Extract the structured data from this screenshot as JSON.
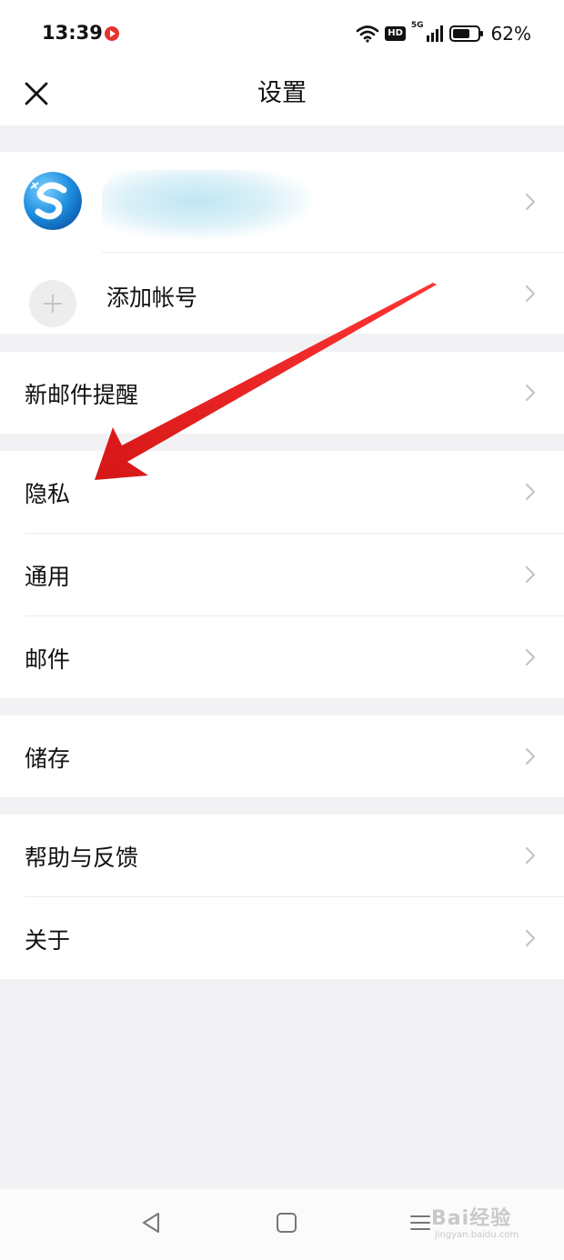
{
  "status_bar": {
    "time": "13:39",
    "hd_badge": "HD",
    "network": "5G",
    "battery": "62%",
    "icons": [
      "record-icon",
      "wifi-icon",
      "signal-icon",
      "battery-icon"
    ]
  },
  "header": {
    "title": "设置"
  },
  "account": {
    "add_label": "添加帐号"
  },
  "menu": {
    "new_mail_alert": "新邮件提醒",
    "privacy": "隐私",
    "general": "通用",
    "mail": "邮件",
    "storage": "储存",
    "help_feedback": "帮助与反馈",
    "about": "关于"
  },
  "watermark": {
    "brand": "Bai经验",
    "url": "jingyan.baidu.com"
  },
  "colors": {
    "background": "#f2f2f4",
    "accent_arrow": "#e01010",
    "chevron": "#c4c4c6"
  }
}
